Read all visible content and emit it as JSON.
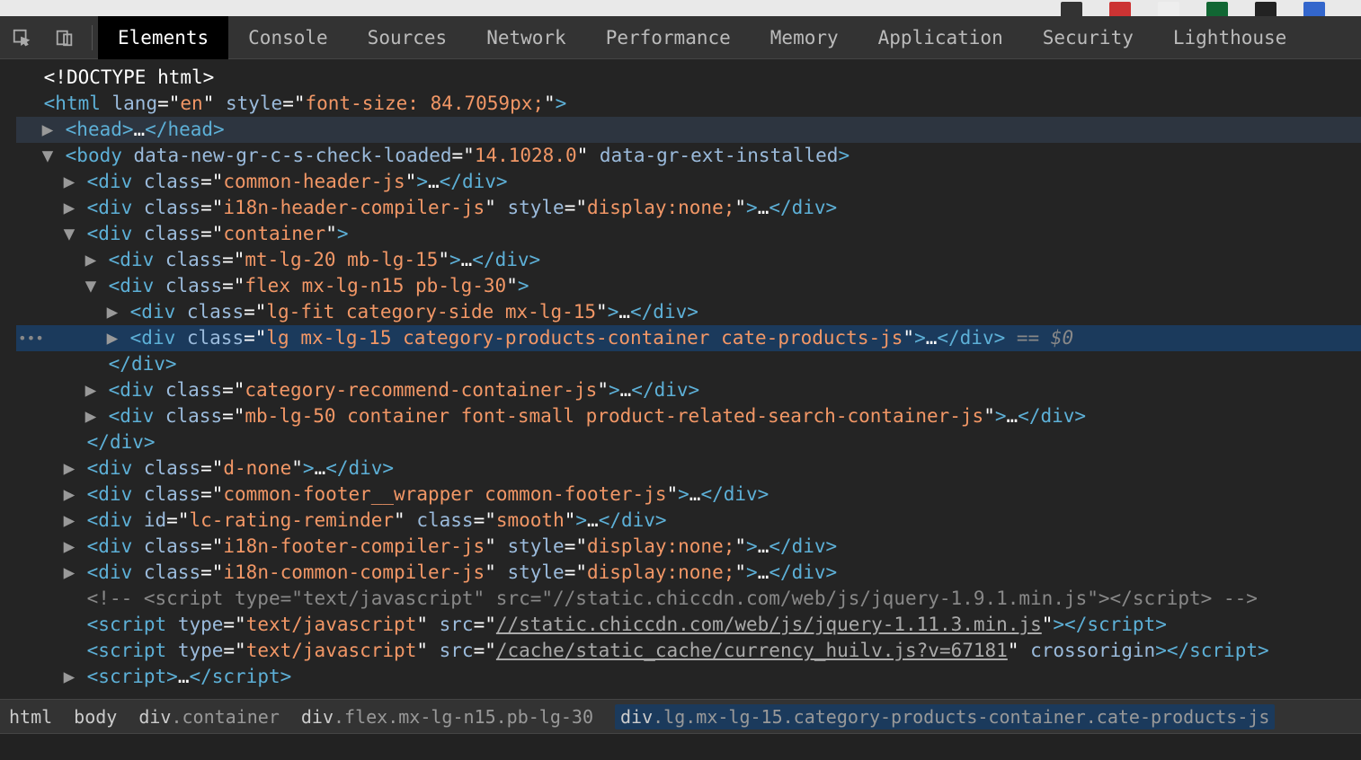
{
  "thumbs": [
    "#333",
    "#c33",
    "#eee",
    "#163",
    "#222",
    "#36c"
  ],
  "tabs": {
    "items": [
      "Elements",
      "Console",
      "Sources",
      "Network",
      "Performance",
      "Memory",
      "Application",
      "Security",
      "Lighthouse"
    ],
    "active": 0
  },
  "crumbs": [
    {
      "tag": "html",
      "cls": ""
    },
    {
      "tag": "body",
      "cls": ""
    },
    {
      "tag": "div",
      "cls": ".container"
    },
    {
      "tag": "div",
      "cls": ".flex.mx-lg-n15.pb-lg-30"
    },
    {
      "tag": "div",
      "cls": ".lg.mx-lg-15.category-products-container.cate-products-js"
    }
  ],
  "tree": [
    {
      "ind": 0,
      "arr": "",
      "html": "<span class='w'>&lt;!DOCTYPE html&gt;</span>"
    },
    {
      "ind": 0,
      "arr": "",
      "html": "<span class='p'>&lt;html </span><span class='a'>lang</span><span class='w'>=\"</span><span class='v'>en</span><span class='w'>\" </span><span class='a'>style</span><span class='w'>=\"</span><span class='v'>font-size: 84.7059px;</span><span class='w'>\"</span><span class='p'>&gt;</span>"
    },
    {
      "ind": 1,
      "arr": "▶",
      "hover": true,
      "html": "<span class='p'>&lt;head&gt;</span><span class='w'>…</span><span class='p'>&lt;/head&gt;</span>"
    },
    {
      "ind": 1,
      "arr": "▼",
      "html": "<span class='p'>&lt;body </span><span class='a'>data-new-gr-c-s-check-loaded</span><span class='w'>=\"</span><span class='v'>14.1028.0</span><span class='w'>\" </span><span class='a'>data-gr-ext-installed</span><span class='p'>&gt;</span>"
    },
    {
      "ind": 2,
      "arr": "▶",
      "html": "<span class='p'>&lt;div </span><span class='a'>class</span><span class='w'>=\"</span><span class='v'>common-header-js</span><span class='w'>\"</span><span class='p'>&gt;</span><span class='w'>…</span><span class='p'>&lt;/div&gt;</span>"
    },
    {
      "ind": 2,
      "arr": "▶",
      "html": "<span class='p'>&lt;div </span><span class='a'>class</span><span class='w'>=\"</span><span class='v'>i18n-header-compiler-js</span><span class='w'>\" </span><span class='a'>style</span><span class='w'>=\"</span><span class='v'>display:none;</span><span class='w'>\"</span><span class='p'>&gt;</span><span class='w'>…</span><span class='p'>&lt;/div&gt;</span>"
    },
    {
      "ind": 2,
      "arr": "▼",
      "html": "<span class='p'>&lt;div </span><span class='a'>class</span><span class='w'>=\"</span><span class='v'>container</span><span class='w'>\"</span><span class='p'>&gt;</span>"
    },
    {
      "ind": 3,
      "arr": "▶",
      "html": "<span class='p'>&lt;div </span><span class='a'>class</span><span class='w'>=\"</span><span class='v'>mt-lg-20 mb-lg-15</span><span class='w'>\"</span><span class='p'>&gt;</span><span class='w'>…</span><span class='p'>&lt;/div&gt;</span>"
    },
    {
      "ind": 3,
      "arr": "▼",
      "html": "<span class='p'>&lt;div </span><span class='a'>class</span><span class='w'>=\"</span><span class='v'>flex mx-lg-n15 pb-lg-30</span><span class='w'>\"</span><span class='p'>&gt;</span>"
    },
    {
      "ind": 4,
      "arr": "▶",
      "html": "<span class='p'>&lt;div </span><span class='a'>class</span><span class='w'>=\"</span><span class='v'>lg-fit category-side mx-lg-15</span><span class='w'>\"</span><span class='p'>&gt;</span><span class='w'>…</span><span class='p'>&lt;/div&gt;</span>"
    },
    {
      "ind": 4,
      "arr": "▶",
      "sel": true,
      "dots": true,
      "html": "<span class='p'>&lt;div </span><span class='a'>class</span><span class='w'>=\"</span><span class='v'>lg mx-lg-15 category-products-container cate-products-js</span><span class='w'>\"</span><span class='p'>&gt;</span><span class='w'>…</span><span class='p'>&lt;/div&gt;</span><span class='g'> == </span><span class='gi'>$0</span>"
    },
    {
      "ind": 3,
      "arr": "",
      "html": "<span class='p'>&lt;/div&gt;</span>"
    },
    {
      "ind": 3,
      "arr": "▶",
      "html": "<span class='p'>&lt;div </span><span class='a'>class</span><span class='w'>=\"</span><span class='v'>category-recommend-container-js</span><span class='w'>\"</span><span class='p'>&gt;</span><span class='w'>…</span><span class='p'>&lt;/div&gt;</span>"
    },
    {
      "ind": 3,
      "arr": "▶",
      "html": "<span class='p'>&lt;div </span><span class='a'>class</span><span class='w'>=\"</span><span class='v'>mb-lg-50 container font-small product-related-search-container-js</span><span class='w'>\"</span><span class='p'>&gt;</span><span class='w'>…</span><span class='p'>&lt;/div&gt;</span>"
    },
    {
      "ind": 2,
      "arr": "",
      "html": "<span class='p'>&lt;/div&gt;</span>"
    },
    {
      "ind": 2,
      "arr": "▶",
      "html": "<span class='p'>&lt;div </span><span class='a'>class</span><span class='w'>=\"</span><span class='v'>d-none</span><span class='w'>\"</span><span class='p'>&gt;</span><span class='w'>…</span><span class='p'>&lt;/div&gt;</span>"
    },
    {
      "ind": 2,
      "arr": "▶",
      "html": "<span class='p'>&lt;div </span><span class='a'>class</span><span class='w'>=\"</span><span class='v'>common-footer__wrapper common-footer-js</span><span class='w'>\"</span><span class='p'>&gt;</span><span class='w'>…</span><span class='p'>&lt;/div&gt;</span>"
    },
    {
      "ind": 2,
      "arr": "▶",
      "html": "<span class='p'>&lt;div </span><span class='a'>id</span><span class='w'>=\"</span><span class='v'>lc-rating-reminder</span><span class='w'>\" </span><span class='a'>class</span><span class='w'>=\"</span><span class='v'>smooth</span><span class='w'>\"</span><span class='p'>&gt;</span><span class='w'>…</span><span class='p'>&lt;/div&gt;</span>"
    },
    {
      "ind": 2,
      "arr": "▶",
      "html": "<span class='p'>&lt;div </span><span class='a'>class</span><span class='w'>=\"</span><span class='v'>i18n-footer-compiler-js</span><span class='w'>\" </span><span class='a'>style</span><span class='w'>=\"</span><span class='v'>display:none;</span><span class='w'>\"</span><span class='p'>&gt;</span><span class='w'>…</span><span class='p'>&lt;/div&gt;</span>"
    },
    {
      "ind": 2,
      "arr": "▶",
      "html": "<span class='p'>&lt;div </span><span class='a'>class</span><span class='w'>=\"</span><span class='v'>i18n-common-compiler-js</span><span class='w'>\" </span><span class='a'>style</span><span class='w'>=\"</span><span class='v'>display:none;</span><span class='w'>\"</span><span class='p'>&gt;</span><span class='w'>…</span><span class='p'>&lt;/div&gt;</span>"
    },
    {
      "ind": 2,
      "arr": "",
      "html": "<span class='g'>&lt;!-- &lt;script type=\"text/javascript\" src=\"//static.chiccdn.com/web/js/jquery-1.9.1.min.js\"&gt;&lt;/script&gt; --&gt;</span>"
    },
    {
      "ind": 2,
      "arr": "",
      "html": "<span class='p'>&lt;script </span><span class='a'>type</span><span class='w'>=\"</span><span class='v'>text/javascript</span><span class='w'>\" </span><span class='a'>src</span><span class='w'>=\"</span><span class='link'>//static.chiccdn.com/web/js/jquery-1.11.3.min.js</span><span class='w'>\"</span><span class='p'>&gt;&lt;/script&gt;</span>"
    },
    {
      "ind": 2,
      "arr": "",
      "html": "<span class='p'>&lt;script </span><span class='a'>type</span><span class='w'>=\"</span><span class='v'>text/javascript</span><span class='w'>\" </span><span class='a'>src</span><span class='w'>=\"</span><span class='link'>/cache/static_cache/currency_huilv.js?v=67181</span><span class='w'>\" </span><span class='a'>crossorigin</span><span class='p'>&gt;&lt;/script&gt;</span>"
    },
    {
      "ind": 2,
      "arr": "▶",
      "html": "<span class='p'>&lt;script&gt;</span><span class='w'>…</span><span class='p'>&lt;/script&gt;</span>"
    }
  ]
}
